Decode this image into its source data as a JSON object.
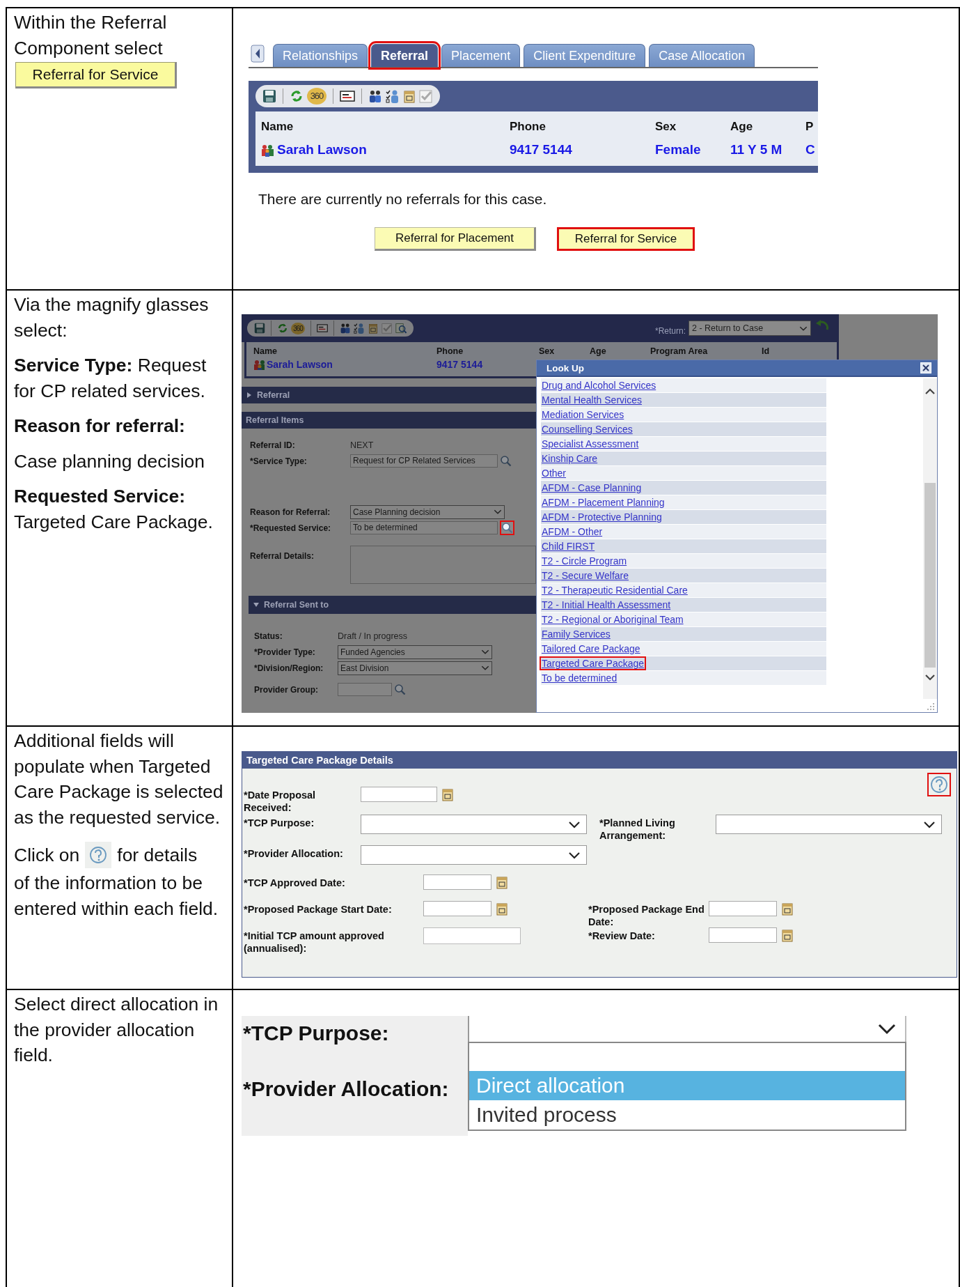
{
  "steps": [
    {
      "kind": "referral_tab",
      "instructions": [
        "Within the Referral Component select"
      ],
      "chip": "Referral for Service",
      "tabs": [
        {
          "label": "Relationships",
          "selected": false,
          "highlighted": false
        },
        {
          "label": "Referral",
          "selected": true,
          "highlighted": true
        },
        {
          "label": "Placement",
          "selected": false,
          "highlighted": false
        },
        {
          "label": "Client Expenditure",
          "selected": false,
          "highlighted": false
        },
        {
          "label": "Case Allocation",
          "selected": false,
          "highlighted": false
        }
      ],
      "toolbar_badge": "360",
      "columns": [
        "Name",
        "Phone",
        "Sex",
        "Age",
        "P"
      ],
      "values": [
        "Sarah Lawson",
        "9417 5144",
        "Female",
        "11 Y 5 M",
        "C"
      ],
      "message": "There are currently no referrals for this case.",
      "buttons": [
        {
          "label": "Referral for Placement",
          "highlighted": false
        },
        {
          "label": "Referral for Service",
          "highlighted": true
        }
      ]
    },
    {
      "kind": "lookup",
      "instructions": [
        "Via the magnify glasses select:",
        "**Service Type:**  Request for CP related services.",
        "**Reason for referral:**",
        "Case planning decision",
        "**Requested Service:** Targeted Care Package."
      ],
      "toolbar_badge": "360",
      "return_label": "*Return:",
      "return_value": "2 - Return to Case",
      "columns": [
        "Name",
        "Phone",
        "Sex",
        "Age",
        "Program Area",
        "Id"
      ],
      "values": [
        "Sarah Lawson",
        "9417 5144"
      ],
      "referral_bar": {
        "title": "Referral",
        "expanded": false
      },
      "items_bar": "Referral Items",
      "items_fields": [
        {
          "kind": "text",
          "label": "Referral ID:",
          "value": "NEXT"
        },
        {
          "kind": "lookup",
          "label": "*Service Type:",
          "value": "Request for CP Related Services",
          "highlighted": false
        },
        {
          "kind": "select",
          "label": "Reason for Referral:",
          "value": "Case Planning decision"
        },
        {
          "kind": "lookup",
          "label": "*Requested Service:",
          "value": "To be determined",
          "highlighted": true
        },
        {
          "kind": "textarea",
          "label": "Referral Details:"
        }
      ],
      "sent_bar": {
        "title": "Referral Sent to",
        "expanded": true
      },
      "sent_fields": [
        {
          "kind": "text",
          "label": "Status:",
          "value": "Draft / In progress"
        },
        {
          "kind": "select",
          "label": "*Provider Type:",
          "value": "Funded Agencies"
        },
        {
          "kind": "select",
          "label": "*Division/Region:",
          "value": "East Division"
        },
        {
          "kind": "lookup",
          "label": "Provider Group:",
          "highlighted": false
        }
      ],
      "popup": {
        "title": "Look Up",
        "items": [
          {
            "label": "Drug and Alcohol Services",
            "highlighted": false
          },
          {
            "label": "Mental Health Services",
            "highlighted": false
          },
          {
            "label": "Mediation Services",
            "highlighted": false
          },
          {
            "label": "Counselling Services",
            "highlighted": false
          },
          {
            "label": "Specialist Assessment",
            "highlighted": false
          },
          {
            "label": "Kinship Care",
            "highlighted": false
          },
          {
            "label": "Other",
            "highlighted": false
          },
          {
            "label": "AFDM - Case Planning",
            "highlighted": false
          },
          {
            "label": "AFDM - Placement Planning",
            "highlighted": false
          },
          {
            "label": "AFDM - Protective Planning",
            "highlighted": false
          },
          {
            "label": "AFDM - Other",
            "highlighted": false
          },
          {
            "label": "Child FIRST",
            "highlighted": false
          },
          {
            "label": "T2 - Circle Program",
            "highlighted": false
          },
          {
            "label": "T2 - Secure Welfare",
            "highlighted": false
          },
          {
            "label": "T2 - Therapeutic Residential Care",
            "highlighted": false
          },
          {
            "label": "T2 - Initial Health Assessment",
            "highlighted": false
          },
          {
            "label": "T2 - Regional or Aboriginal Team",
            "highlighted": false
          },
          {
            "label": "Family Services",
            "highlighted": false
          },
          {
            "label": "Tailored Care Package",
            "highlighted": false
          },
          {
            "label": "Targeted Care Package",
            "highlighted": true
          },
          {
            "label": "To be determined",
            "highlighted": false
          }
        ]
      }
    },
    {
      "kind": "details_form",
      "instructions": [
        "Additional fields will populate when Targeted Care Package is selected as the requested service."
      ],
      "help_note": {
        "before": "Click on",
        "after": "for details",
        "continuation": "of the information to be entered within each field."
      },
      "form_title": "Targeted Care Package Details",
      "help_highlighted": true,
      "rows": [
        {
          "left": {
            "kind": "date",
            "label": "*Date Proposal Received:"
          }
        },
        {
          "left": {
            "kind": "select",
            "label": "*TCP Purpose:"
          },
          "right": {
            "kind": "select",
            "label": "*Planned Living Arrangement:"
          }
        },
        {
          "left": {
            "kind": "select",
            "label": "*Provider Allocation:"
          }
        },
        {
          "left": {
            "kind": "date",
            "label": "*TCP Approved Date:"
          }
        },
        {
          "left": {
            "kind": "date",
            "label": "*Proposed Package Start Date:"
          },
          "right": {
            "kind": "date",
            "label": "*Proposed Package End Date:"
          }
        },
        {
          "left": {
            "kind": "text",
            "label": "*Initial TCP amount approved (annualised):"
          },
          "right": {
            "kind": "date",
            "label": "*Review Date:"
          }
        }
      ]
    },
    {
      "kind": "dropdown_zoom",
      "instructions": [
        "Select direct allocation in the provider allocation field."
      ],
      "labels": [
        "*TCP Purpose:",
        "*Provider Allocation:"
      ],
      "options": [
        {
          "label": "Direct allocation",
          "selected": true
        },
        {
          "label": "Invited process",
          "selected": false
        }
      ]
    }
  ]
}
